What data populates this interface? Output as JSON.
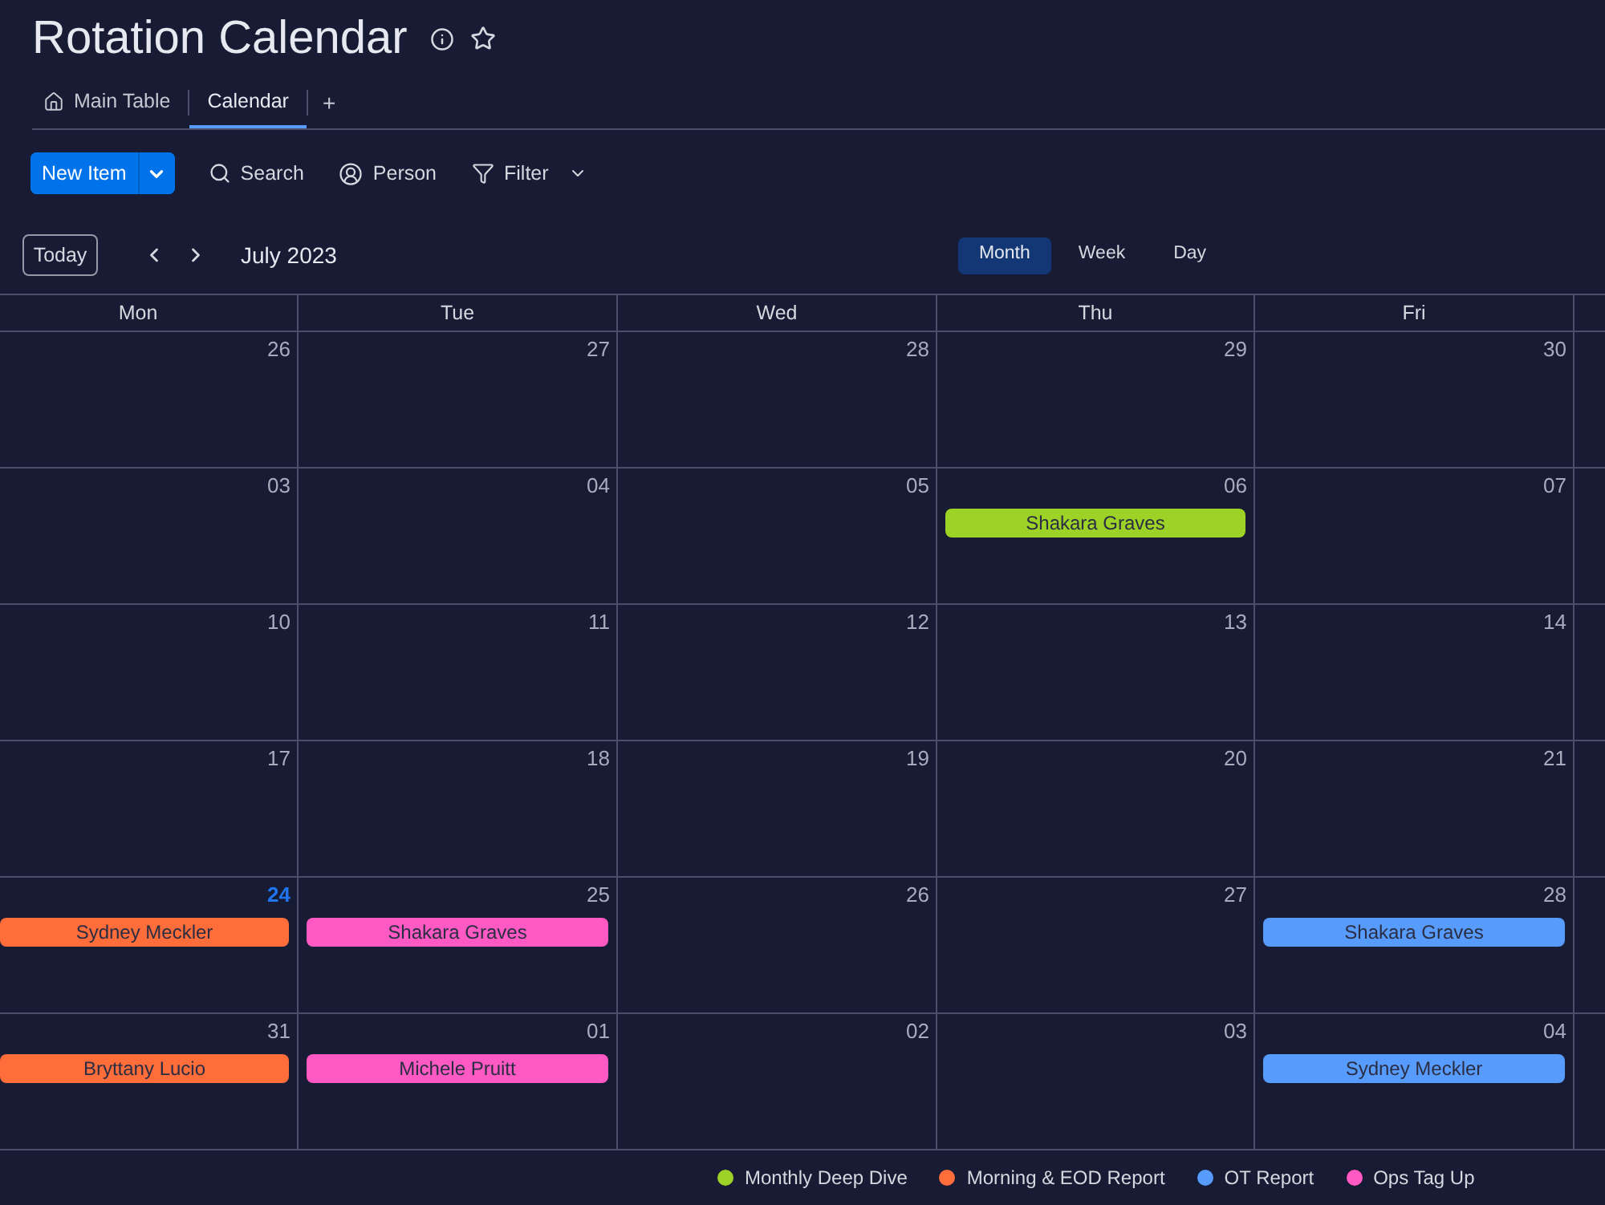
{
  "board": {
    "title": "Rotation Calendar"
  },
  "views": [
    {
      "label": "Main Table",
      "kind": "home",
      "selected": false
    },
    {
      "label": "Calendar",
      "kind": "plain",
      "selected": true
    }
  ],
  "add_view": "+",
  "toolbar": {
    "new_item": "New Item",
    "actions": [
      {
        "kind": "search",
        "label": "Search"
      },
      {
        "kind": "person",
        "label": "Person"
      },
      {
        "kind": "filter",
        "label": "Filter"
      }
    ]
  },
  "calendar": {
    "today_button": "Today",
    "period": "July 2023",
    "modes": [
      {
        "label": "Month",
        "selected": true
      },
      {
        "label": "Week",
        "selected": false
      },
      {
        "label": "Day",
        "selected": false
      }
    ],
    "weekdays": [
      "Mon",
      "Tue",
      "Wed",
      "Thu",
      "Fri"
    ],
    "weeks": [
      {
        "days": [
          {
            "day": "26",
            "today": false
          },
          {
            "day": "27",
            "today": false
          },
          {
            "day": "28",
            "today": false
          },
          {
            "day": "29",
            "today": false
          },
          {
            "day": "30",
            "today": false
          }
        ]
      },
      {
        "days": [
          {
            "day": "03",
            "today": false
          },
          {
            "day": "04",
            "today": false
          },
          {
            "day": "05",
            "today": false
          },
          {
            "day": "06",
            "today": false,
            "events": [
              {
                "name": "Shakara Graves",
                "color": "#9cd326"
              }
            ]
          },
          {
            "day": "07",
            "today": false
          }
        ]
      },
      {
        "days": [
          {
            "day": "10",
            "today": false
          },
          {
            "day": "11",
            "today": false
          },
          {
            "day": "12",
            "today": false
          },
          {
            "day": "13",
            "today": false
          },
          {
            "day": "14",
            "today": false
          }
        ]
      },
      {
        "days": [
          {
            "day": "17",
            "today": false
          },
          {
            "day": "18",
            "today": false
          },
          {
            "day": "19",
            "today": false
          },
          {
            "day": "20",
            "today": false
          },
          {
            "day": "21",
            "today": false
          }
        ]
      },
      {
        "days": [
          {
            "day": "24",
            "today": true,
            "events": [
              {
                "name": "Sydney Meckler",
                "color": "#ff6d3b"
              }
            ]
          },
          {
            "day": "25",
            "today": false,
            "events": [
              {
                "name": "Shakara Graves",
                "color": "#ff5ac4"
              }
            ]
          },
          {
            "day": "26",
            "today": false
          },
          {
            "day": "27",
            "today": false
          },
          {
            "day": "28",
            "today": false,
            "events": [
              {
                "name": "Shakara Graves",
                "color": "#579bfc"
              }
            ]
          }
        ]
      },
      {
        "days": [
          {
            "day": "31",
            "today": false,
            "events": [
              {
                "name": "Bryttany Lucio",
                "color": "#ff6d3b"
              }
            ]
          },
          {
            "day": "01",
            "today": false,
            "events": [
              {
                "name": "Michele Pruitt",
                "color": "#ff5ac4"
              }
            ]
          },
          {
            "day": "02",
            "today": false
          },
          {
            "day": "03",
            "today": false
          },
          {
            "day": "04",
            "today": false,
            "events": [
              {
                "name": "Sydney Meckler",
                "color": "#579bfc"
              }
            ]
          }
        ]
      }
    ]
  },
  "legend": [
    {
      "label": "Monthly Deep Dive",
      "color": "#9cd326"
    },
    {
      "label": "Morning & EOD Report",
      "color": "#ff6d3b"
    },
    {
      "label": "OT Report",
      "color": "#579bfc"
    },
    {
      "label": "Ops Tag Up",
      "color": "#ff5ac4"
    }
  ]
}
